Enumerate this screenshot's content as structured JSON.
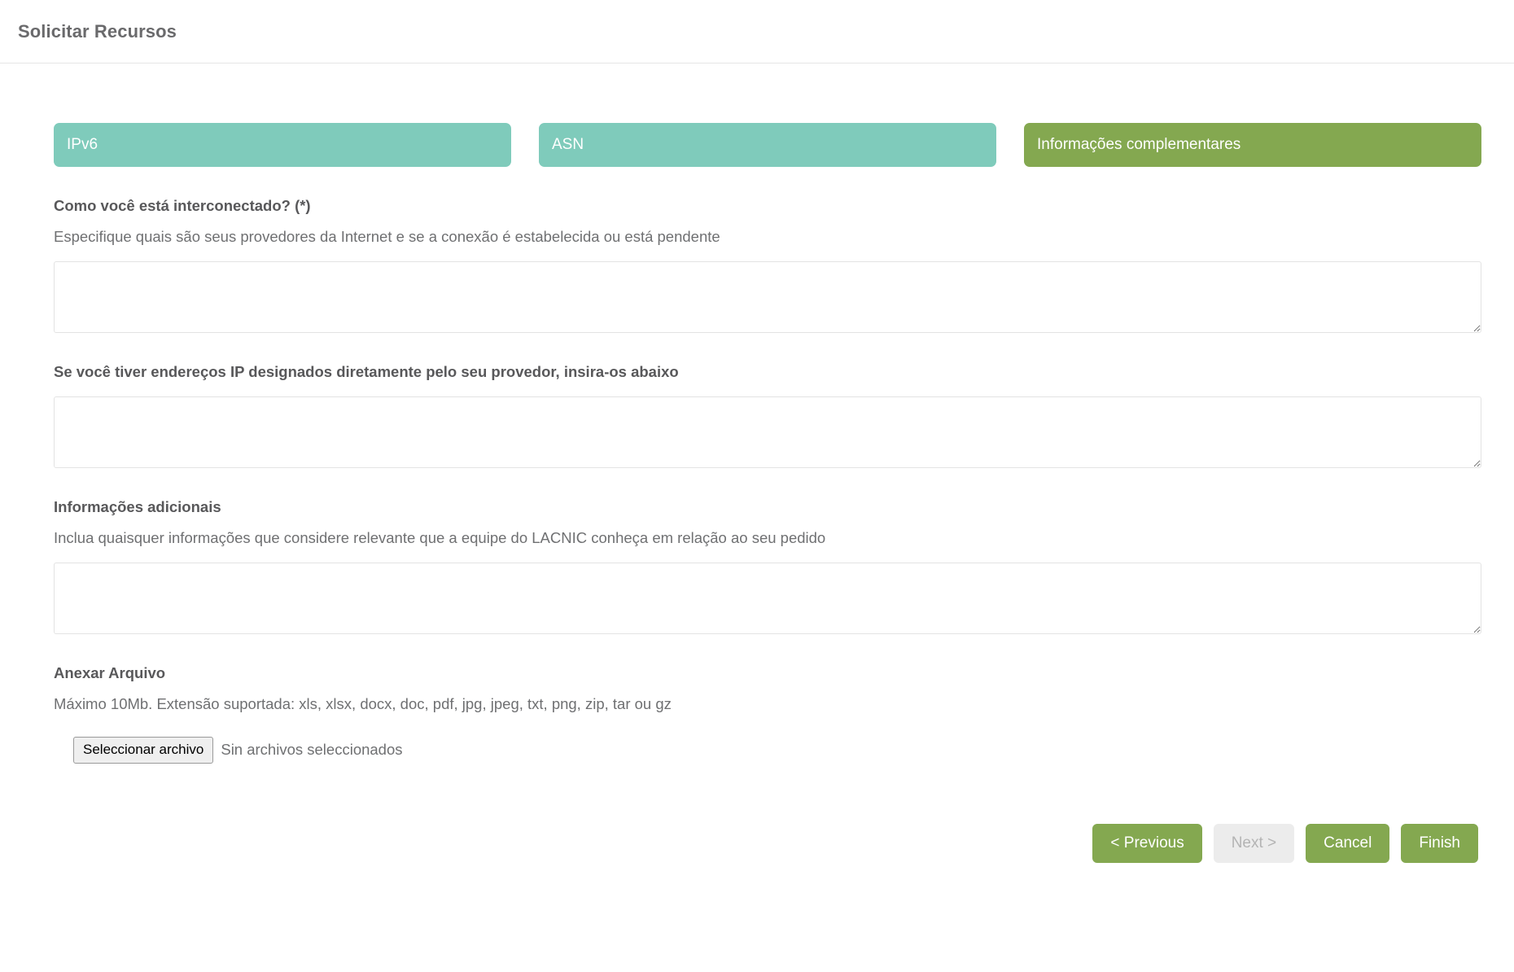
{
  "header": {
    "title": "Solicitar Recursos"
  },
  "steps": [
    {
      "label": "IPv6",
      "state": "done"
    },
    {
      "label": "ASN",
      "state": "done"
    },
    {
      "label": "Informações complementares",
      "state": "current"
    }
  ],
  "fields": [
    {
      "label": "Como você está interconectado? (*)",
      "help": "Especifique quais são seus provedores da Internet e se a conexão é estabelecida ou está pendente",
      "value": "",
      "placeholder": ""
    },
    {
      "label": "Se você tiver endereços IP designados diretamente pelo seu provedor, insira-os abaixo",
      "help": "",
      "value": "",
      "placeholder": ""
    },
    {
      "label": "Informações adicionais",
      "help": "Inclua quaisquer informações que considere relevante que a equipe do LACNIC conheça em relação ao seu pedido",
      "value": "",
      "placeholder": ""
    }
  ],
  "attachment": {
    "label": "Anexar Arquivo",
    "help": "Máximo 10Mb. Extensão suportada: xls, xlsx, docx, doc, pdf, jpg, jpeg, txt, png, zip, tar ou gz",
    "button_label": "Seleccionar archivo",
    "status": "Sin archivos seleccionados"
  },
  "actions": {
    "previous": "< Previous",
    "next": "Next >",
    "cancel": "Cancel",
    "finish": "Finish"
  },
  "colors": {
    "step_done": "#7fcbbb",
    "step_current": "#84a850",
    "button": "#84a850",
    "button_disabled_bg": "#ececec",
    "button_disabled_text": "#b4b4b4",
    "text": "#58585a",
    "border": "#e3e3e3"
  }
}
